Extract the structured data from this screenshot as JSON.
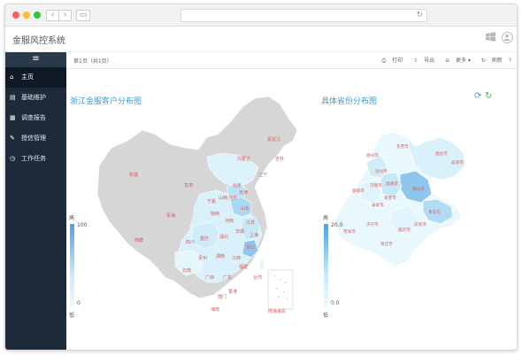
{
  "header": {
    "title": "金服风控系统"
  },
  "sidebar": {
    "menu_icon": "≡",
    "items": [
      {
        "label": "主页",
        "icon": "home-icon"
      },
      {
        "label": "基础维护",
        "icon": "file-icon"
      },
      {
        "label": "调查报告",
        "icon": "report-icon"
      },
      {
        "label": "授信管理",
        "icon": "edit-icon"
      },
      {
        "label": "工作任务",
        "icon": "clock-icon"
      }
    ]
  },
  "toolbar": {
    "breadcrumb": "第1页（共1页）",
    "print": "打印",
    "export": "导出",
    "more": "更多",
    "refresh": "刷新",
    "help": "?"
  },
  "left_map": {
    "title": "浙江金服客户分布图",
    "legend_high": "高",
    "legend_low": "低",
    "legend_max": "100",
    "legend_min": "0",
    "provinces": [
      "黑龙江",
      "吉林",
      "辽宁",
      "内蒙古",
      "北京",
      "天津",
      "河北",
      "山西",
      "山东",
      "宁夏",
      "甘肃",
      "新疆",
      "青海",
      "西藏",
      "陕西",
      "河南",
      "江苏",
      "安徽",
      "上海",
      "四川",
      "湖北",
      "重庆",
      "浙江",
      "贵州",
      "湖南",
      "江西",
      "云南",
      "广西",
      "广东",
      "福建",
      "台湾",
      "澳门",
      "香港",
      "海南",
      "南海诸岛"
    ]
  },
  "right_map": {
    "title": "具体省份分布图",
    "legend_high": "高",
    "legend_low": "低",
    "legend_max": "20.0",
    "legend_min": "0.0",
    "cities": [
      "烟台市",
      "威海市",
      "东营市",
      "德州市",
      "滨州市",
      "潍坊市",
      "淄博市",
      "聊城市",
      "济南市",
      "莱芜市",
      "青岛市",
      "泰安市",
      "日照市",
      "菏泽市",
      "济宁市",
      "临沂市",
      "枣庄市"
    ]
  }
}
